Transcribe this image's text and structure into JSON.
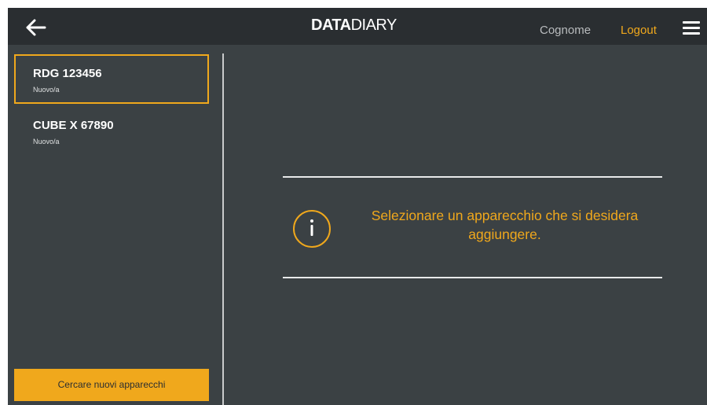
{
  "header": {
    "logo_bold": "DATA",
    "logo_light": "DIARY",
    "user_name": "Cognome",
    "logout_label": "Logout",
    "back_icon": "arrow-left-icon",
    "menu_icon": "hamburger-menu-icon"
  },
  "sidebar": {
    "devices": [
      {
        "name": "RDG 123456",
        "status": "Nuovo/a",
        "selected": true
      },
      {
        "name": "CUBE X 67890",
        "status": "Nuovo/a",
        "selected": false
      }
    ],
    "search_button_label": "Cercare nuovi apparecchi"
  },
  "main": {
    "info_icon": "info-icon",
    "message": "Selezionare un apparecchio che si desidera aggiungere."
  },
  "colors": {
    "accent": "#f0a81c",
    "background": "#3b4144",
    "topbar": "#2a2e31",
    "text": "#ffffff"
  }
}
